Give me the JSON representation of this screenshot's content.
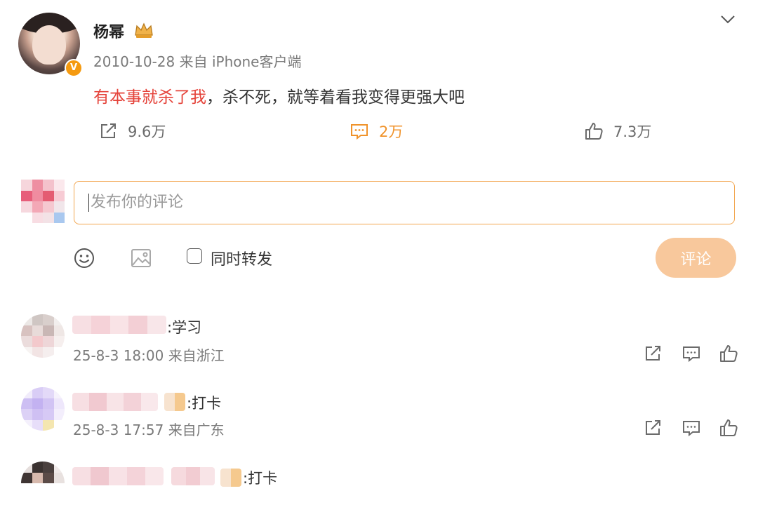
{
  "post": {
    "username": "杨幂",
    "verified_badge": "V",
    "date": "2010-10-28",
    "source": "来自 iPhone客户端",
    "text_highlight": "有本事就杀了我",
    "text_rest": "，杀不死，就等着看我变得更强大吧",
    "repost_count": "9.6万",
    "comment_count": "2万",
    "like_count": "7.3万"
  },
  "compose": {
    "placeholder": "发布你的评论",
    "also_repost_label": "同时转发",
    "submit_label": "评论"
  },
  "comments": [
    {
      "text": ":学习",
      "date": "25-8-3 18:00",
      "source": "来自浙江"
    },
    {
      "text": ":打卡",
      "date": "25-8-3 17:57",
      "source": "来自广东"
    },
    {
      "text": ":打卡"
    }
  ],
  "colors": {
    "accent": "#f0932b",
    "highlight_red": "#e5433a",
    "submit_button_bg": "#f8c89c",
    "input_border": "#f2a650"
  }
}
